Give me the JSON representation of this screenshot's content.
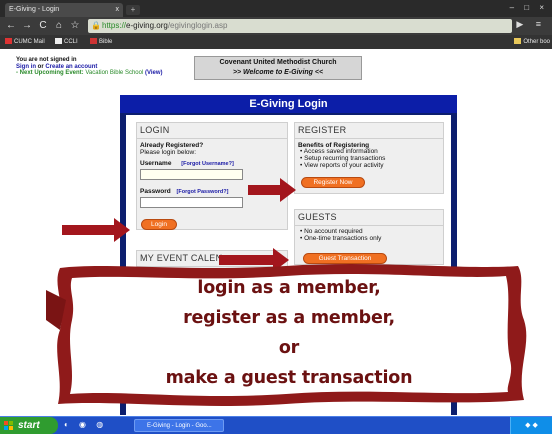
{
  "browser": {
    "tab_title": "E-Giving - Login",
    "tab_close": "x",
    "url_scheme": "https://",
    "url_domain": "e-giving.org",
    "url_path": "/egivinglogin.asp",
    "bookmarks": [
      {
        "label": "CUMC Mail",
        "icon": "mail-icon"
      },
      {
        "label": "CCLI",
        "icon": "ccli-icon"
      },
      {
        "label": "Bible",
        "icon": "bible-icon"
      }
    ],
    "other_bookmarks": "Other boo"
  },
  "page": {
    "signin_status": "You are not signed in",
    "signin_link": "Sign in",
    "signin_or": "or",
    "create_account": "Create an account",
    "upcoming_prefix": "- Next Upcoming Event:",
    "upcoming_event": "Vacation Bible School",
    "view_link": "(View)",
    "church_name": "Covenant United Methodist Church",
    "welcome": ">> Welcome to E-Giving <<"
  },
  "egiving": {
    "title": "E-Giving Login",
    "login": {
      "heading": "LOGIN",
      "already": "Already Registered?",
      "please": "Please login below:",
      "username_label": "Username",
      "forgot_username": "[Forgot Username?]",
      "password_label": "Password",
      "forgot_password": "[Forgot Password?]",
      "login_button": "Login"
    },
    "register": {
      "heading": "REGISTER",
      "benefits_title": "Benefits of Registering",
      "benefits": [
        "Access saved information",
        "Setup recurring transactions",
        "View reports of your activity"
      ],
      "button": "Register Now"
    },
    "guests": {
      "heading": "GUESTS",
      "items": [
        "No account required",
        "One-time transactions only"
      ],
      "button": "Guest Transaction"
    },
    "event_calendar": {
      "heading": "MY EVENT CALEN"
    }
  },
  "banner": {
    "lines": [
      "login as a member,",
      "register as a member,",
      "or",
      "make a guest transaction"
    ],
    "color": "#6b1111"
  },
  "taskbar": {
    "start": "start",
    "task_item": "E-Giving - Login - Goo..."
  }
}
